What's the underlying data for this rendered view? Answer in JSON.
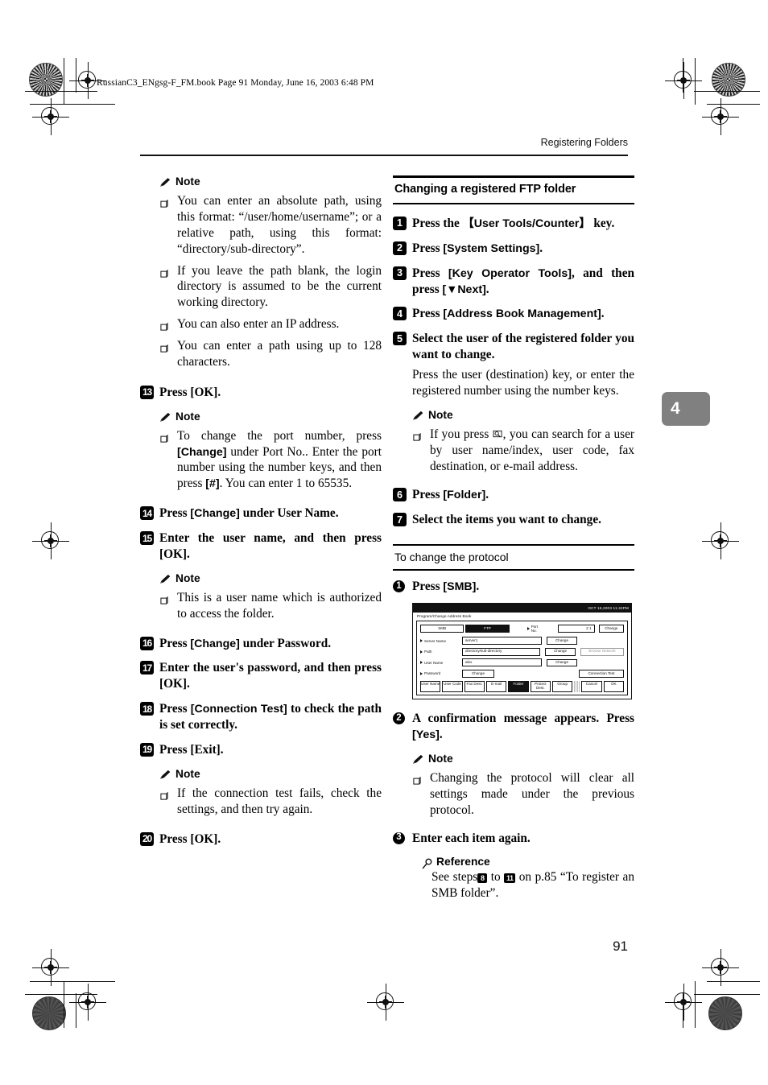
{
  "file_header": "RussianC3_ENgsg-F_FM.book  Page 91  Monday, June 16, 2003  6:48 PM",
  "running_head": "Registering Folders",
  "chapter_tab": "4",
  "page_number": "91",
  "labels": {
    "note": "Note",
    "reference": "Reference",
    "pencil_icon": "pencil-icon",
    "magnifier_icon": "magnifier-icon",
    "search_icon": "search-icon",
    "bullet_icon": "square-bullet-icon"
  },
  "left_column": {
    "note_top": {
      "heading": "Note",
      "items": [
        "You can enter an absolute path, using this format: “/user/home/username”; or a relative path, using this format: “directory/sub-directory”.",
        "If you leave the path blank, the login directory is assumed to be the current working directory.",
        "You can also enter an IP address.",
        "You can enter a path using up to 128 characters."
      ]
    },
    "steps": [
      {
        "num": "13",
        "text": "Press [OK]."
      },
      {
        "num": "14",
        "text_pre": "Press ",
        "key": "[Change]",
        "text_post": " under User Name."
      },
      {
        "num": "15",
        "text": "Enter the user name, and then press [OK]."
      },
      {
        "num": "16",
        "text_pre": "Press ",
        "key": "[Change]",
        "text_post": " under Password."
      },
      {
        "num": "17",
        "text": "Enter the user's password, and then press [OK]."
      },
      {
        "num": "18",
        "text_pre": "Press ",
        "key": "[Connection Test]",
        "text_post": " to check the path is set correctly."
      },
      {
        "num": "19",
        "text": "Press [Exit]."
      },
      {
        "num": "20",
        "text": "Press [OK]."
      }
    ],
    "note_port": {
      "heading": "Note",
      "item_pre": "To change the port number, press ",
      "item_key1": "[Change]",
      "item_mid": " under Port No.. Enter the port number using the number keys, and then press ",
      "item_key2": "[#]",
      "item_post": ". You can enter 1 to 65535."
    },
    "note_username": {
      "heading": "Note",
      "items": [
        "This is a user name which is authorized to access the folder."
      ]
    },
    "note_conntest": {
      "heading": "Note",
      "items": [
        "If the connection test fails, check the settings, and then try again."
      ]
    }
  },
  "right_column": {
    "heading": "Changing a registered FTP folder",
    "steps": [
      {
        "num": "1",
        "text_pre": "Press the ",
        "key": "【User Tools/Counter】",
        "text_post": " key."
      },
      {
        "num": "2",
        "text_pre": "Press ",
        "key": "[System Settings]",
        "text_post": "."
      },
      {
        "num": "3",
        "text_pre": "Press ",
        "key": "[Key Operator Tools]",
        "text_post": ", and then press ",
        "key2": "[▼Next]",
        "text_post2": "."
      },
      {
        "num": "4",
        "text_pre": "Press ",
        "key": "[Address Book Management]",
        "text_post": "."
      },
      {
        "num": "5",
        "text": "Select the user of the registered folder you want to change."
      },
      {
        "num": "6",
        "text_pre": "Press ",
        "key": "[Folder]",
        "text_post": "."
      },
      {
        "num": "7",
        "text": "Select the items you want to change."
      }
    ],
    "step5_sub": "Press the user (destination) key, or enter the registered number using the number keys.",
    "note_search": {
      "heading": "Note",
      "item_pre": "If you press ",
      "item_post": ", you can search for a user by user name/index, user code, fax destination, or e-mail address."
    },
    "subheading": "To change the protocol",
    "substeps": [
      {
        "num": "1",
        "text_pre": "Press ",
        "key": "[SMB]",
        "text_post": "."
      },
      {
        "num": "2",
        "text_pre": "A confirmation message appears. Press ",
        "key": "[Yes]",
        "text_post": "."
      },
      {
        "num": "3",
        "text": "Enter each item again."
      }
    ],
    "note_protocol": {
      "heading": "Note",
      "items": [
        "Changing the protocol will clear all settings made under the previous protocol."
      ]
    },
    "reference": {
      "heading": "Reference",
      "text_pre": "See steps",
      "step_from": "8",
      "text_mid": " to ",
      "step_to": "11",
      "text_post": " on p.85 “To register an SMB folder”."
    }
  },
  "lcd_screenshot": {
    "status_bar": "OCT  16,2003  11:42PM",
    "window_title": "Program/Change Address Book",
    "protocol_tabs": [
      {
        "label": "SMB",
        "selected": false
      },
      {
        "label": "FTP",
        "selected": true
      }
    ],
    "port": {
      "label": "Port No.",
      "value": "2 1",
      "button": "Change"
    },
    "fields": [
      {
        "label": "Server Name",
        "value": "server1",
        "button": "Change",
        "extra": ""
      },
      {
        "label": "Path",
        "value": "directory/sub-directory",
        "button": "Change",
        "extra": "Browse Network"
      },
      {
        "label": "User Name",
        "value": "alex",
        "button": "Change",
        "extra": ""
      },
      {
        "label": "Password",
        "value": "",
        "button": "Change",
        "extra": "Connection Test"
      }
    ],
    "bottom_tabs": [
      {
        "label": "User Name",
        "selected": false
      },
      {
        "label": "User Code",
        "selected": false
      },
      {
        "label": "Fax Dest.",
        "selected": false
      },
      {
        "label": "E-mail",
        "selected": false
      },
      {
        "label": "Folder",
        "selected": true
      },
      {
        "label": "Protect Dest.",
        "selected": false
      },
      {
        "label": "Group",
        "selected": false
      }
    ],
    "actions": [
      {
        "label": "Cancel"
      },
      {
        "label": "OK"
      }
    ]
  }
}
